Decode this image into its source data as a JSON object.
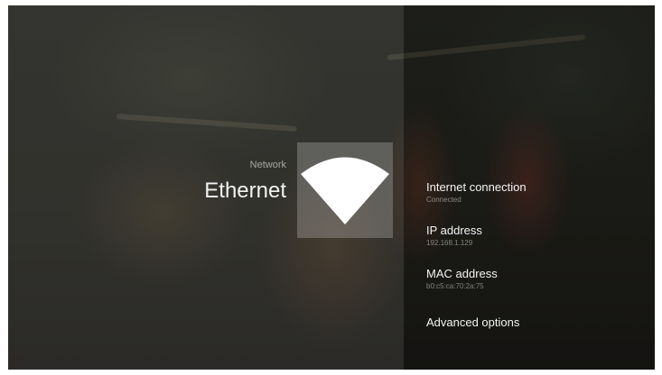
{
  "header": {
    "section": "Network",
    "title": "Ethernet"
  },
  "icon": {
    "name": "wifi-signal-icon",
    "color": "#ffffff"
  },
  "menu": {
    "items": [
      {
        "label": "Internet connection",
        "value": "Connected"
      },
      {
        "label": "IP address",
        "value": "192.168.1.129"
      },
      {
        "label": "MAC address",
        "value": "b0:c5:ca:70:2a:75"
      },
      {
        "label": "Advanced options"
      }
    ]
  }
}
